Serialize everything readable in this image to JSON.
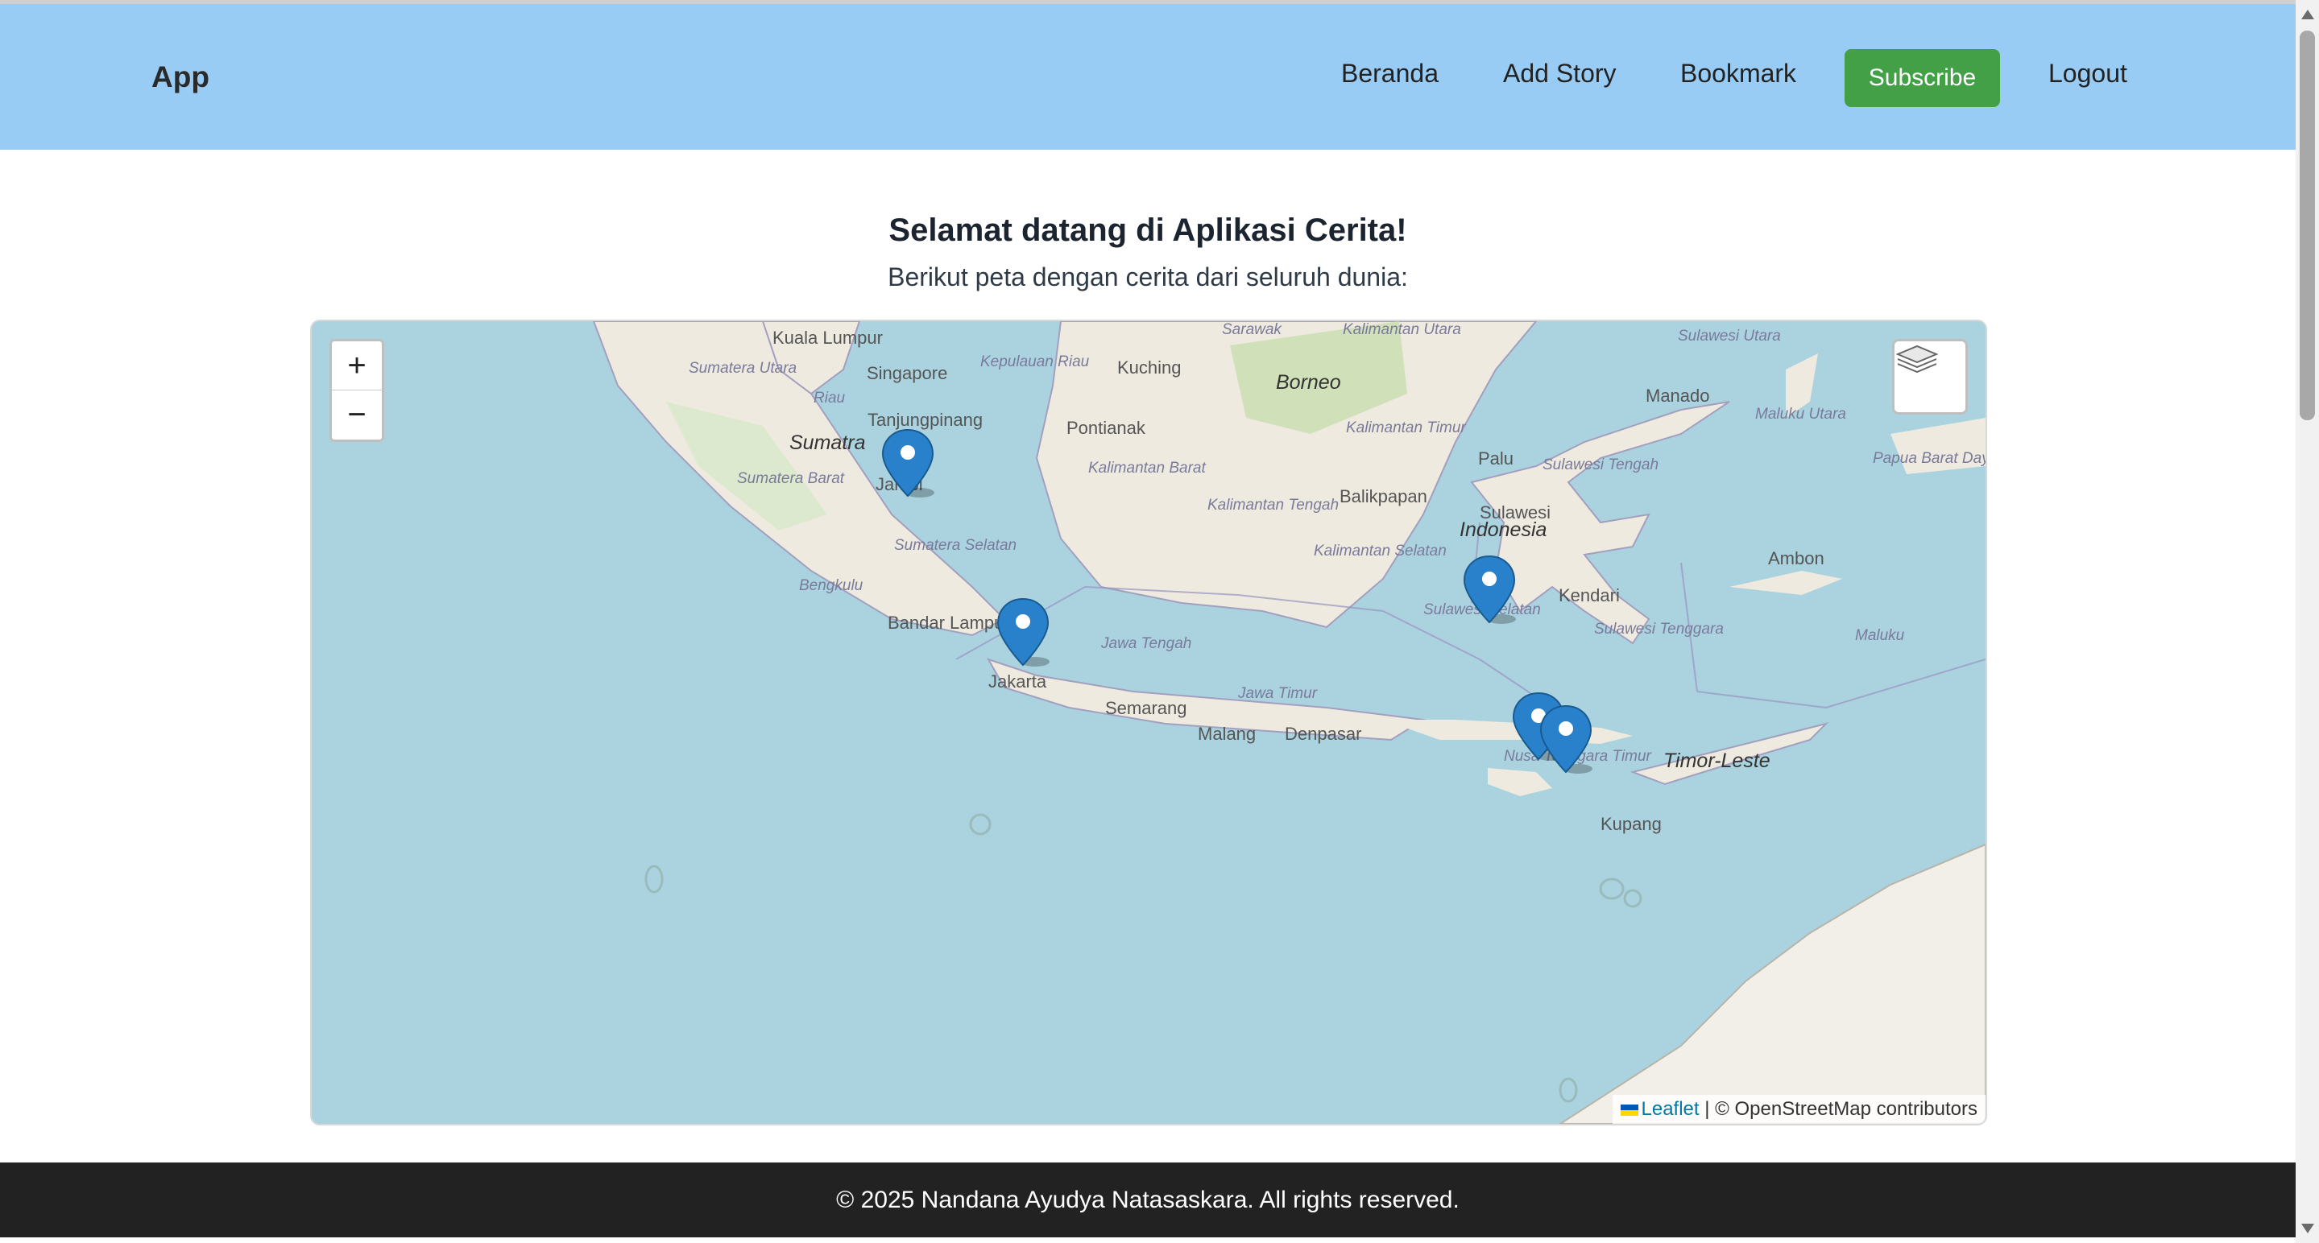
{
  "header": {
    "brand": "App",
    "nav": [
      {
        "label": "Beranda"
      },
      {
        "label": "Add Story"
      },
      {
        "label": "Bookmark"
      },
      {
        "label": "Logout"
      }
    ],
    "subscribe_label": "Subscribe",
    "bg_color": "#99ccf5",
    "subscribe_color": "#43a047"
  },
  "main": {
    "title": "Selamat datang di Aplikasi Cerita!",
    "subtitle": "Berikut peta dengan cerita dari seluruh dunia:"
  },
  "map": {
    "zoom_in": "+",
    "zoom_out": "−",
    "attribution_leaflet": "Leaflet",
    "attribution_rest": " | © OpenStreetMap contributors",
    "labels": [
      "Kuala Lumpur",
      "Singapore",
      "Sumatera Utara",
      "Riau",
      "Kepulauan Riau",
      "Tanjungpinang",
      "Sumatra",
      "Sumatera Barat",
      "Jambi",
      "Sumatera Selatan",
      "Bengkulu",
      "Bandar Lampung",
      "Jakarta",
      "Jawa Tengah",
      "Semarang",
      "Jawa Timur",
      "Malang",
      "Denpasar",
      "Kuching",
      "Sarawak",
      "Kalimantan Utara",
      "Borneo",
      "Pontianak",
      "Kalimantan Barat",
      "Kalimantan Tengah",
      "Kalimantan Timur",
      "Balikpapan",
      "Kalimantan Selatan",
      "Palu",
      "Sulawesi Tengah",
      "Sulawesi",
      "Indonesia",
      "Sulawesi Selatan",
      "Kendari",
      "Sulawesi Tenggara",
      "Sulawesi Utara",
      "Manado",
      "Maluku Utara",
      "Papua Barat Daya",
      "Ambon",
      "Maluku",
      "Nusa Tenggara Timur",
      "Timor-Leste",
      "Kupang"
    ],
    "markers": [
      {
        "name": "Jambi"
      },
      {
        "name": "Jakarta"
      },
      {
        "name": "Sulawesi Selatan"
      },
      {
        "name": "Nusa Tenggara Timur 1"
      },
      {
        "name": "Nusa Tenggara Timur 2"
      }
    ]
  },
  "footer": {
    "text": "© 2025 Nandana Ayudya Natasaskara. All rights reserved."
  }
}
